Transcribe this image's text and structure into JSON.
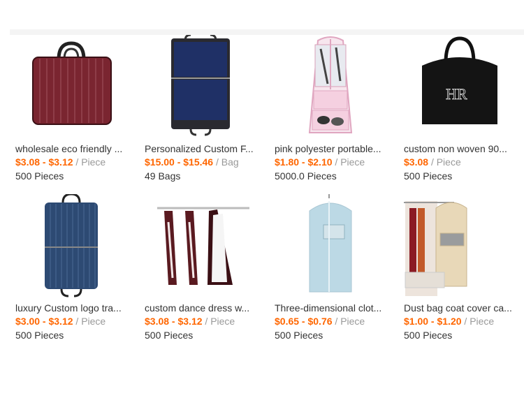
{
  "products": [
    {
      "title": "wholesale eco friendly ...",
      "price": "$3.08 - $3.12",
      "unit": "Piece",
      "moq": "500 Pieces",
      "image": "burgundy-garment-bag"
    },
    {
      "title": "Personalized Custom F...",
      "price": "$15.00 - $15.46",
      "unit": "Bag",
      "moq": "49 Bags",
      "image": "navy-garment-bag"
    },
    {
      "title": "pink polyester portable...",
      "price": "$1.80 - $2.10",
      "unit": "Piece",
      "moq": "5000.0 Pieces",
      "image": "pink-clear-garment-bag"
    },
    {
      "title": "custom non woven 90...",
      "price": "$3.08",
      "unit": "Piece",
      "moq": "500 Pieces",
      "image": "black-hr-garment-bag"
    },
    {
      "title": "luxury Custom logo tra...",
      "price": "$3.00 - $3.12",
      "unit": "Piece",
      "moq": "500 Pieces",
      "image": "blue-striped-garment-bag"
    },
    {
      "title": "custom dance dress w...",
      "price": "$3.08 - $3.12",
      "unit": "Piece",
      "moq": "500 Pieces",
      "image": "dance-dress-bags"
    },
    {
      "title": "Three-dimensional clot...",
      "price": "$0.65 - $0.76",
      "unit": "Piece",
      "moq": "500 Pieces",
      "image": "light-blue-suit-cover"
    },
    {
      "title": "Dust bag coat cover ca...",
      "price": "$1.00 - $1.20",
      "unit": "Piece",
      "moq": "500 Pieces",
      "image": "beige-coat-cover"
    }
  ],
  "logo_text": "HR"
}
